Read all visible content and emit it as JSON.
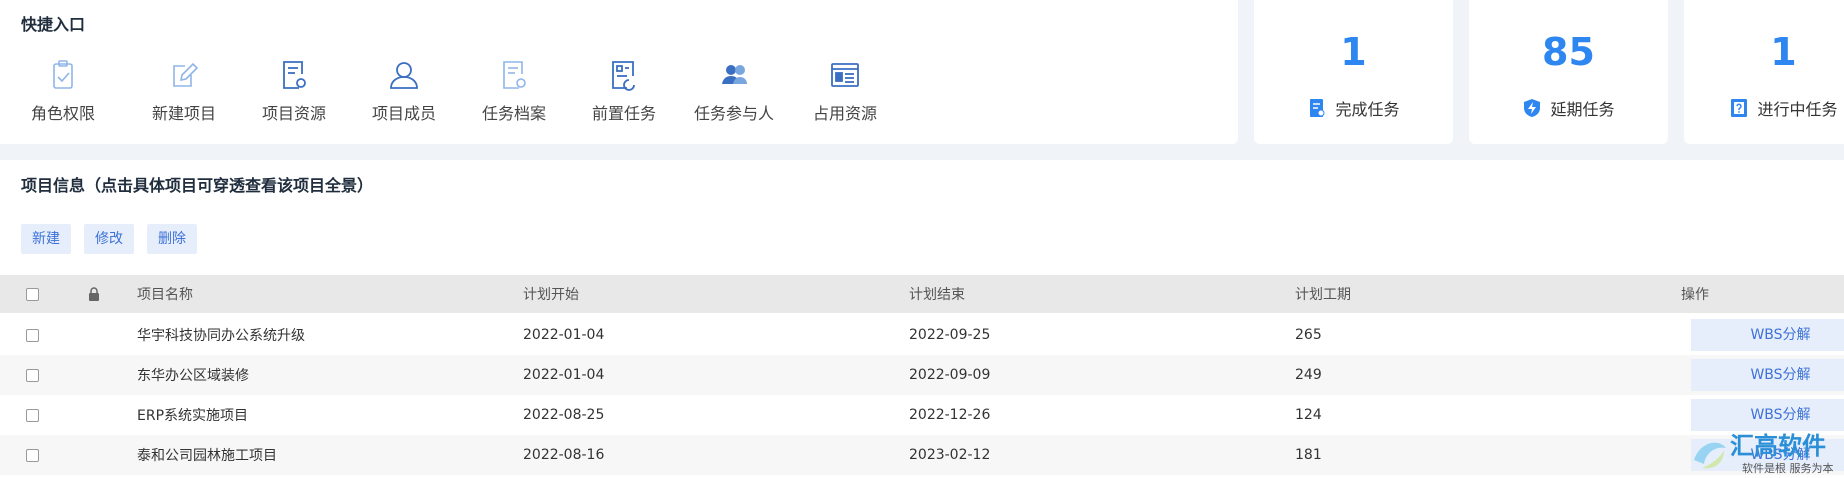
{
  "quick": {
    "title": "快捷入口",
    "items": [
      {
        "label": "角色权限",
        "icon": "clipboard-check-icon"
      },
      {
        "label": "新建项目",
        "icon": "edit-document-icon"
      },
      {
        "label": "项目资源",
        "icon": "document-settings-icon"
      },
      {
        "label": "项目成员",
        "icon": "user-icon"
      },
      {
        "label": "任务档案",
        "icon": "document-settings-icon"
      },
      {
        "label": "前置任务",
        "icon": "task-flow-icon"
      },
      {
        "label": "任务参与人",
        "icon": "participants-icon"
      },
      {
        "label": "占用资源",
        "icon": "resource-list-icon"
      }
    ]
  },
  "stats": [
    {
      "value": "1",
      "label": "完成任务",
      "icon": "document-icon"
    },
    {
      "value": "85",
      "label": "延期任务",
      "icon": "shield-bolt-icon"
    },
    {
      "value": "1",
      "label": "进行中任务",
      "icon": "question-box-icon"
    }
  ],
  "project": {
    "title": "项目信息（点击具体项目可穿透查看该项目全景）",
    "buttons": {
      "new": "新建",
      "edit": "修改",
      "delete": "删除"
    },
    "columns": {
      "name": "项目名称",
      "start": "计划开始",
      "end": "计划结束",
      "duration": "计划工期",
      "action": "操作"
    },
    "rows": [
      {
        "name": "华宇科技协同办公系统升级",
        "start": "2022-01-04",
        "end": "2022-09-25",
        "duration": "265",
        "action": "WBS分解"
      },
      {
        "name": "东华办公区域装修",
        "start": "2022-01-04",
        "end": "2022-09-09",
        "duration": "249",
        "action": "WBS分解"
      },
      {
        "name": "ERP系统实施项目",
        "start": "2022-08-25",
        "end": "2022-12-26",
        "duration": "124",
        "action": "WBS分解"
      },
      {
        "name": "泰和公司园林施工项目",
        "start": "2022-08-16",
        "end": "2023-02-12",
        "duration": "181",
        "action": "WBS分解"
      }
    ]
  },
  "watermark": {
    "brand": "汇高软件",
    "slogan": "软件是根 服务为本"
  },
  "colors": {
    "accent": "#2e86f0",
    "icon_light": "#8fb5e8",
    "icon_dark": "#3a6fc2",
    "button_bg": "#e6eefc",
    "button_text": "#3e72d6"
  }
}
